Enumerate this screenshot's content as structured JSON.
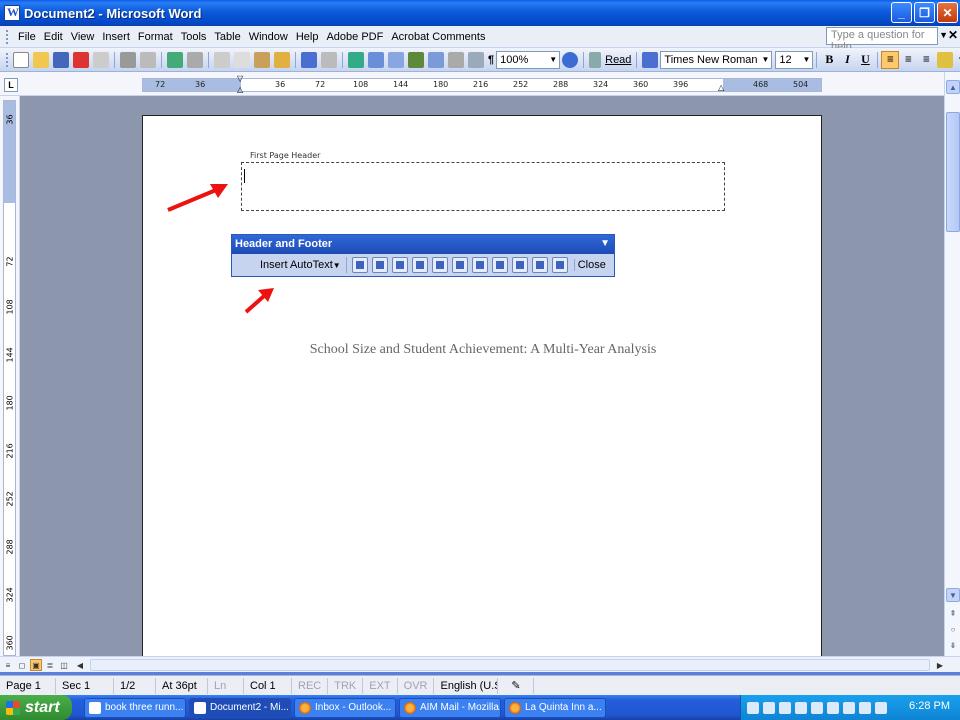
{
  "window": {
    "title": "Document2 - Microsoft Word"
  },
  "menubar": {
    "items": [
      "File",
      "Edit",
      "View",
      "Insert",
      "Format",
      "Tools",
      "Table",
      "Window",
      "Help",
      "Adobe PDF",
      "Acrobat Comments"
    ],
    "help_placeholder": "Type a question for help"
  },
  "toolbar": {
    "zoom": "100%",
    "read_label": "Read",
    "font": "Times New Roman",
    "size": "12",
    "bold": "B",
    "italic": "I",
    "underline": "U"
  },
  "ruler": {
    "h_ticks": [
      "72",
      "36",
      "36",
      "72",
      "108",
      "144",
      "180",
      "216",
      "252",
      "288",
      "324",
      "360",
      "396",
      "468",
      "504"
    ],
    "v_ticks": [
      "36",
      "72",
      "108",
      "144",
      "180",
      "216",
      "252",
      "288",
      "324",
      "360"
    ]
  },
  "document": {
    "header_label": "First Page Header",
    "title": "School Size and Student Achievement: A Multi-Year Analysis"
  },
  "header_footer_toolbar": {
    "title": "Header and Footer",
    "insert_autotext": "Insert AutoText",
    "close": "Close"
  },
  "statusbar": {
    "page": "Page 1",
    "section": "Sec 1",
    "pages": "1/2",
    "at": "At 36pt",
    "ln": "Ln",
    "col": "Col 1",
    "rec": "REC",
    "trk": "TRK",
    "ext": "EXT",
    "ovr": "OVR",
    "language": "English (U.S."
  },
  "taskbar": {
    "start": "start",
    "tasks": [
      "book three runn...",
      "Document2 - Mi...",
      "Inbox - Outlook...",
      "AIM Mail - Mozilla...",
      "La Quinta Inn a..."
    ],
    "clock": "6:28 PM"
  },
  "colors": {
    "accent_arrow": "#ee1111",
    "title_bar": "#0b5bdb"
  }
}
